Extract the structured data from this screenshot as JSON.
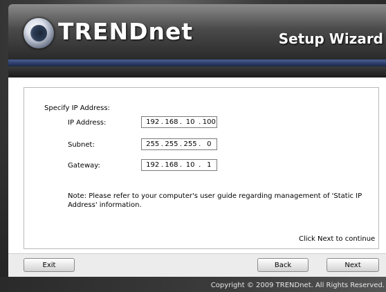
{
  "header": {
    "brand": "TRENDnet",
    "title": "Setup Wizard"
  },
  "form": {
    "section_label": "Specify IP Address:",
    "fields": [
      {
        "label": "IP Address:",
        "octets": [
          "192",
          "168",
          "10",
          "100"
        ]
      },
      {
        "label": "Subnet:",
        "octets": [
          "255",
          "255",
          "255",
          "0"
        ]
      },
      {
        "label": "Gateway:",
        "octets": [
          "192",
          "168",
          "10",
          "1"
        ]
      }
    ],
    "note": "Note: Please refer to your computer's user guide regarding management of 'Static IP Address' information.",
    "continue_hint": "Click Next to continue"
  },
  "buttons": {
    "exit": "Exit",
    "back": "Back",
    "next": "Next"
  },
  "footer": {
    "copyright": "Copyright © 2009 TRENDnet. All Rights Reserved."
  },
  "colors": {
    "accent_bar": "#2c3c68",
    "panel_bg": "#ffffff"
  }
}
